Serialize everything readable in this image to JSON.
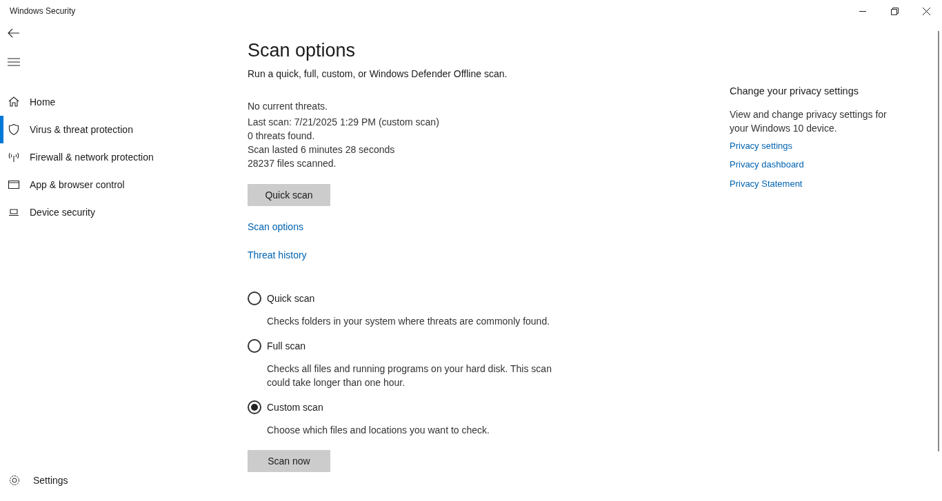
{
  "window": {
    "title": "Windows Security"
  },
  "nav": {
    "items": [
      {
        "label": "Home",
        "kind": "home",
        "selected": false
      },
      {
        "label": "Virus & threat protection",
        "kind": "shield",
        "selected": true
      },
      {
        "label": "Firewall & network protection",
        "kind": "antenna",
        "selected": false
      },
      {
        "label": "App & browser control",
        "kind": "window",
        "selected": false
      },
      {
        "label": "Device security",
        "kind": "laptop",
        "selected": false
      }
    ],
    "settings": "Settings"
  },
  "page": {
    "title": "Scan options",
    "subtitle": "Run a quick, full, custom, or Windows Defender Offline scan.",
    "status": [
      "No current threats.",
      "Last scan: 7/21/2025 1:29 PM (custom scan)",
      "0 threats found.",
      "Scan lasted 6 minutes 28 seconds",
      "28237 files scanned."
    ],
    "quick_button": "Quick scan",
    "links": [
      "Scan options",
      "Threat history"
    ],
    "options": [
      {
        "label": "Quick scan",
        "description": "Checks folders in your system where threats are commonly found.",
        "selected": false
      },
      {
        "label": "Full scan",
        "description": "Checks all files and running programs on your hard disk. This scan could take longer than one hour.",
        "selected": false
      },
      {
        "label": "Custom scan",
        "description": "Choose which files and locations you want to check.",
        "selected": true
      }
    ],
    "scan_button": "Scan now"
  },
  "side": {
    "title": "Change your privacy settings",
    "text": "View and change privacy settings for your Windows 10 device.",
    "links": [
      "Privacy settings",
      "Privacy dashboard",
      "Privacy Statement"
    ]
  }
}
